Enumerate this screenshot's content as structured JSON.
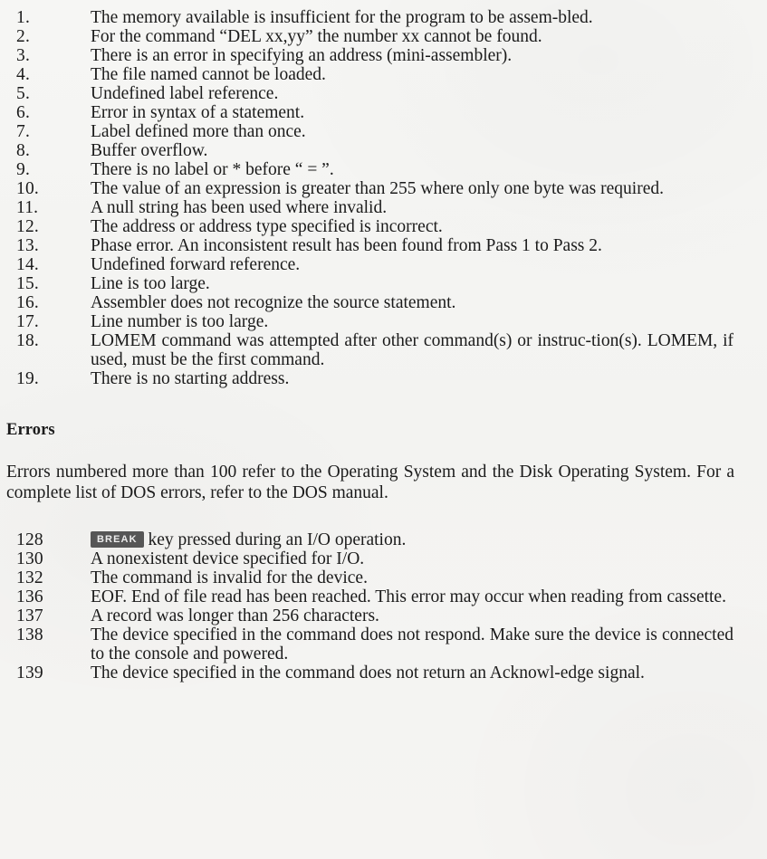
{
  "document": {
    "type": "scanned-manual-page",
    "assembler_errors": {
      "items": [
        {
          "number": "1.",
          "text": "The memory available is insufficient for the program to be assem-bled."
        },
        {
          "number": "2.",
          "text": "For the command “DEL xx,yy” the number xx cannot be found."
        },
        {
          "number": "3.",
          "text": "There is an error in specifying an address (mini-assembler)."
        },
        {
          "number": "4.",
          "text": "The file named cannot be loaded."
        },
        {
          "number": "5.",
          "text": "Undefined label reference."
        },
        {
          "number": "6.",
          "text": "Error in syntax of a statement."
        },
        {
          "number": "7.",
          "text": "Label defined more than once."
        },
        {
          "number": "8.",
          "text": "Buffer overflow."
        },
        {
          "number": "9.",
          "text": "There is no label or * before “ = ”."
        },
        {
          "number": "10.",
          "text": "The value of an expression is greater than 255 where only one byte was required."
        },
        {
          "number": "11.",
          "text": "A null string has been used where invalid."
        },
        {
          "number": "12.",
          "text": "The address or address type specified is incorrect."
        },
        {
          "number": "13.",
          "text": "Phase error. An inconsistent result has been found from Pass 1 to Pass 2."
        },
        {
          "number": "14.",
          "text": "Undefined forward reference."
        },
        {
          "number": "15.",
          "text": "Line is too large."
        },
        {
          "number": "16.",
          "text": "Assembler does not recognize the source statement."
        },
        {
          "number": "17.",
          "text": "Line number is too large."
        },
        {
          "number": "18.",
          "text": "LOMEM command was attempted after other command(s) or instruc-tion(s). LOMEM, if used, must be the first command."
        },
        {
          "number": "19.",
          "text": "There is no starting address."
        }
      ]
    },
    "errors_section": {
      "heading": "Errors",
      "intro": "Errors numbered more than 100 refer to the Operating System and the Disk Operating System. For a complete list of DOS errors, refer to the DOS manual.",
      "items": [
        {
          "number": "128",
          "keycap": "BREAK",
          "text": "key pressed during an I/O operation."
        },
        {
          "number": "130",
          "text": "A nonexistent device specified for I/O."
        },
        {
          "number": "132",
          "text": "The command is invalid for the device."
        },
        {
          "number": "136",
          "text": "EOF. End of file read has been reached. This error may occur when reading from cassette."
        },
        {
          "number": "137",
          "text": "A record was longer than 256 characters."
        },
        {
          "number": "138",
          "text": "The device specified in the command does not respond. Make sure the device is connected to the console and powered."
        },
        {
          "number": "139",
          "text": "The device specified in the command does not return an Acknowl-edge signal."
        }
      ]
    }
  }
}
